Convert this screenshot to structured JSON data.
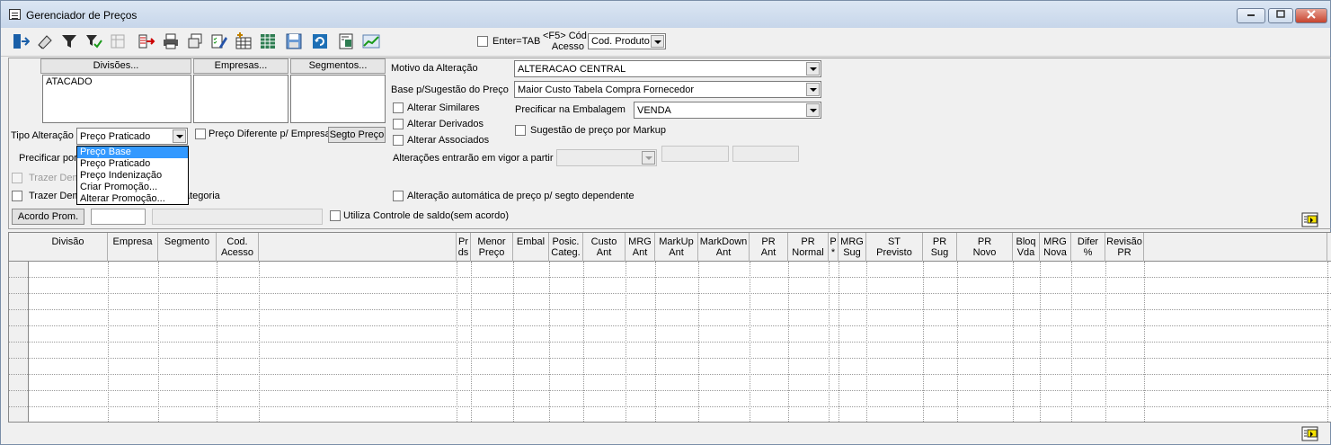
{
  "window": {
    "title": "Gerenciador de Preços"
  },
  "toolbar": {
    "enter_tab_label": "Enter=TAB",
    "cod_acesso_label_line1": "<F5> Cód",
    "cod_acesso_label_line2": "Acesso",
    "cod_acesso_value": "Cod. Produto"
  },
  "filters": {
    "divisoes_button": "Divisões...",
    "empresas_button": "Empresas...",
    "segmentos_button": "Segmentos...",
    "divisoes_items": [
      "ATACADO"
    ],
    "tipo_alteracao_label": "Tipo Alteração",
    "tipo_alteracao_value": "Preço Praticado",
    "preco_diferente_label": "Preço Diferente p/ Empresa",
    "segto_preco_button": "Segto Preço",
    "precificar_por_label": "Precificar por",
    "trazer_dem_1": "Trazer Dem",
    "trazer_dem_2": "Trazer Dem",
    "categoria_fragment": "ategoria",
    "acordo_prom_button": "Acordo Prom.",
    "utiliza_controle_label": "Utiliza Controle de saldo(sem acordo)"
  },
  "dropdown": {
    "options": [
      "Preço Base",
      "Preço Praticado",
      "Preço Indenização",
      "Criar Promoção...",
      "Alterar Promoção..."
    ],
    "selected_index": 0
  },
  "right_panel": {
    "motivo_label": "Motivo da Alteração",
    "motivo_value": "ALTERACAO CENTRAL",
    "base_label": "Base p/Sugestão do Preço",
    "base_value": "Maior Custo Tabela Compra Fornecedor",
    "alterar_similares": "Alterar Similares",
    "alterar_derivados": "Alterar Derivados",
    "alterar_associados": "Alterar Associados",
    "precificar_embalagem_label": "Precificar na Embalagem",
    "precificar_embalagem_value": "VENDA",
    "sugestao_markup": "Sugestão de preço por Markup",
    "vigor_label": "Alterações entrarão em vigor a partir",
    "alteracao_automatica": "Alteração automática de preço p/ segto dependente"
  },
  "grid": {
    "columns": [
      {
        "l1": "Divisão",
        "l2": ""
      },
      {
        "l1": "Empresa",
        "l2": ""
      },
      {
        "l1": "Segmento",
        "l2": ""
      },
      {
        "l1": "Cod.",
        "l2": "Acesso"
      },
      {
        "l1": "",
        "l2": ""
      },
      {
        "l1": "Pr",
        "l2": "ds"
      },
      {
        "l1": "Menor",
        "l2": "Preço"
      },
      {
        "l1": "Embal",
        "l2": ""
      },
      {
        "l1": "Posic.",
        "l2": "Categ."
      },
      {
        "l1": "Custo",
        "l2": "Ant"
      },
      {
        "l1": "MRG",
        "l2": "Ant"
      },
      {
        "l1": "MarkUp",
        "l2": "Ant"
      },
      {
        "l1": "MarkDown",
        "l2": "Ant"
      },
      {
        "l1": "PR",
        "l2": "Ant"
      },
      {
        "l1": "PR",
        "l2": "Normal"
      },
      {
        "l1": "P",
        "l2": "*"
      },
      {
        "l1": "MRG",
        "l2": "Sug"
      },
      {
        "l1": "ST",
        "l2": "Previsto"
      },
      {
        "l1": "PR Sug",
        "l2": ""
      },
      {
        "l1": "PR",
        "l2": "Novo"
      },
      {
        "l1": "Bloq",
        "l2": "Vda"
      },
      {
        "l1": "MRG",
        "l2": "Nova"
      },
      {
        "l1": "Difer",
        "l2": "%"
      },
      {
        "l1": "Revisão",
        "l2": "PR"
      },
      {
        "l1": "",
        "l2": ""
      }
    ],
    "row_count": 10
  }
}
